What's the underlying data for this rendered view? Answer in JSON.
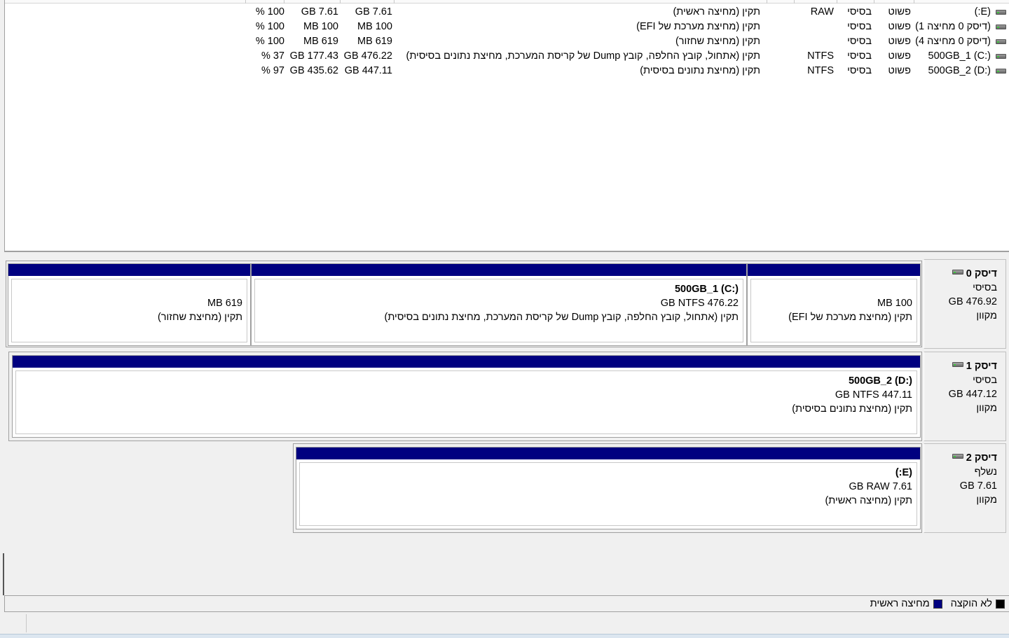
{
  "volumes": [
    {
      "name": "(E:)",
      "layout": "פשוט",
      "type": "בסיסי",
      "fs": "RAW",
      "status": "תקין (מחיצה ראשית)",
      "capacity": "GB 7.61",
      "free": "GB 7.61",
      "pct_free": "% 100"
    },
    {
      "name": "(דיסק 0 מחיצה 1)",
      "layout": "פשוט",
      "type": "בסיסי",
      "fs": "",
      "status": "תקין (מחיצת מערכת של EFI)",
      "capacity": "MB 100",
      "free": "MB 100",
      "pct_free": "% 100"
    },
    {
      "name": "(דיסק 0 מחיצה 4)",
      "layout": "פשוט",
      "type": "בסיסי",
      "fs": "",
      "status": "תקין (מחיצת שחזור)",
      "capacity": "MB 619",
      "free": "MB 619",
      "pct_free": "% 100"
    },
    {
      "name": "500GB_1 (C:)",
      "layout": "פשוט",
      "type": "בסיסי",
      "fs": "NTFS",
      "status": "תקין (אתחול, קובץ החלפה, קובץ Dump של קריסת המערכת, מחיצת נתונים בסיסית)",
      "capacity": "GB 476.22",
      "free": "GB 177.43",
      "pct_free": "% 37"
    },
    {
      "name": "500GB_2 (D:)",
      "layout": "פשוט",
      "type": "בסיסי",
      "fs": "NTFS",
      "status": "תקין (מחיצת נתונים בסיסית)",
      "capacity": "GB 447.11",
      "free": "GB 435.62",
      "pct_free": "% 97"
    }
  ],
  "disks": [
    {
      "title": "דיסק 0",
      "kind": "בסיסי",
      "size": "GB 476.92",
      "state": "מקוון",
      "partitions": [
        {
          "l1": "",
          "l2": "MB 100",
          "l3": "תקין (מחיצת מערכת של EFI)"
        },
        {
          "l1": "500GB_1  (C:)",
          "l2": "GB NTFS 476.22",
          "l3": "תקין (אתחול, קובץ החלפה, קובץ Dump של קריסת המערכת, מחיצת נתונים בסיסית)"
        },
        {
          "l1": "",
          "l2": "MB 619",
          "l3": "תקין (מחיצת שחזור)"
        }
      ]
    },
    {
      "title": "דיסק 1",
      "kind": "בסיסי",
      "size": "GB 447.12",
      "state": "מקוון",
      "partitions": [
        {
          "l1": "500GB_2  (D:)",
          "l2": "GB NTFS 447.11",
          "l3": "תקין (מחיצת נתונים בסיסית)"
        }
      ]
    },
    {
      "title": "דיסק 2",
      "kind": "נשלף",
      "size": "GB 7.61",
      "state": "מקוון",
      "partitions": [
        {
          "l1": "(E:)",
          "l2": "GB RAW 7.61",
          "l3": "תקין (מחיצה ראשית)"
        }
      ]
    }
  ],
  "legend": [
    {
      "label": "לא הוקצה",
      "color": "#000000"
    },
    {
      "label": "מחיצה ראשית",
      "color": "#000080"
    }
  ],
  "colors": {
    "primary_partition": "#000080",
    "unallocated": "#000000"
  }
}
